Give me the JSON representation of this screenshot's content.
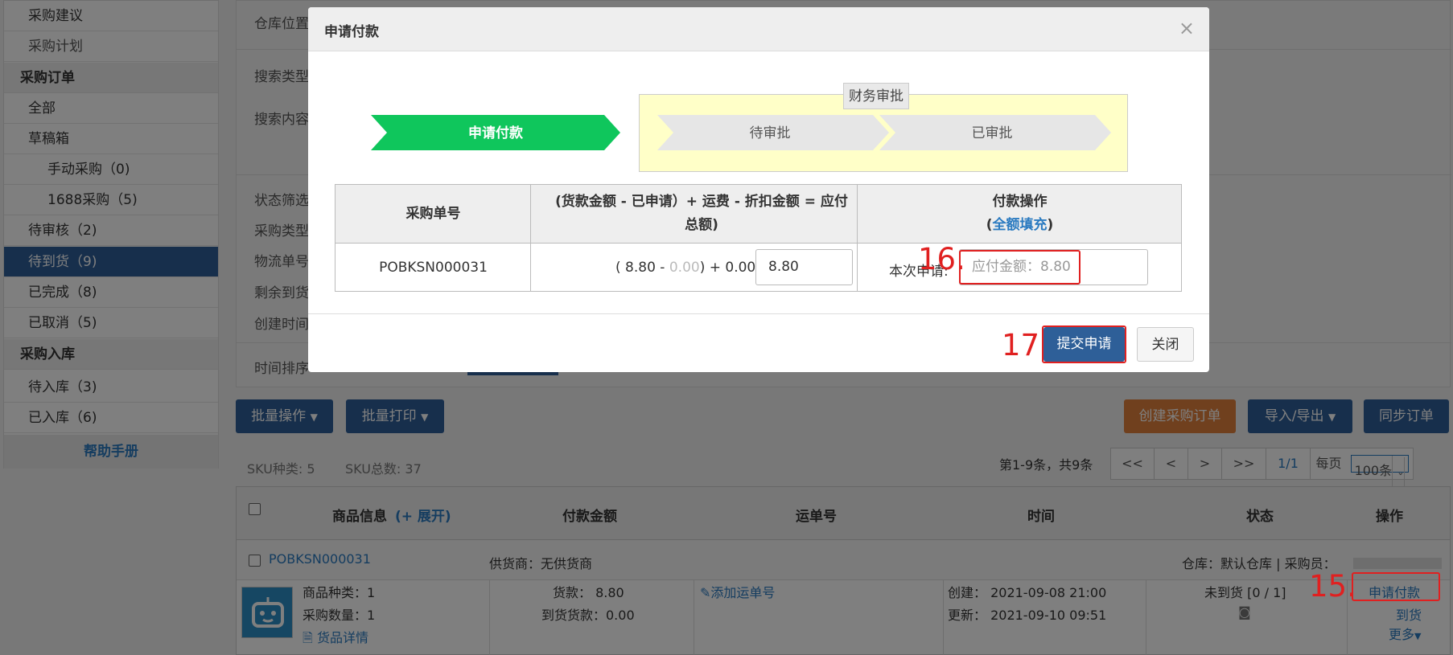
{
  "sidebar": {
    "items": [
      {
        "label": "采购建议"
      },
      {
        "label": "采购计划"
      },
      {
        "label": "采购订单"
      },
      {
        "label": "全部"
      },
      {
        "label": "草稿箱"
      },
      {
        "label": "手动采购（0)"
      },
      {
        "label": "1688采购（5)"
      },
      {
        "label": "待审核（2)"
      },
      {
        "label": "待到货（9)"
      },
      {
        "label": "已完成（8)"
      },
      {
        "label": "已取消（5)"
      },
      {
        "label": "采购入库"
      },
      {
        "label": "待入库（3)"
      },
      {
        "label": "已入库（6)"
      }
    ],
    "help": "帮助手册"
  },
  "filters": {
    "warehouse": "仓库位置",
    "search_type": "搜索类型",
    "search_content": "搜索内容",
    "status": "状态筛选",
    "purchase_type": "采购类型",
    "logistics": "物流单号",
    "remaining": "剩余到货",
    "created": "创建时间",
    "sort": "时间排序"
  },
  "toolbar": {
    "batch_ops": "批量操作",
    "batch_print": "批量打印",
    "create_order": "创建采购订单",
    "import_export": "导入/导出",
    "sync_order": "同步订单"
  },
  "stats": {
    "sku_kinds": "SKU种类: 5",
    "sku_total": "SKU总数: 37",
    "range": "第1-9条，共9条"
  },
  "pager": {
    "first": "<<",
    "prev": "<",
    "next": ">",
    "last": ">>",
    "page": "1/1",
    "per_page_label": "每页",
    "per_page": "100条"
  },
  "table": {
    "headers": {
      "product": "商品信息",
      "expand": "(+ 展开)",
      "amount": "付款金额",
      "tracking": "运单号",
      "time": "时间",
      "status": "状态",
      "action": "操作"
    },
    "order": {
      "id": "POBKSN000031",
      "supplier": "供货商：无供货商",
      "warehouse": "仓库：默认仓库 | 采购员："
    },
    "row": {
      "kinds": "商品种类：1",
      "qty": "采购数量：1",
      "detail": "货品详情",
      "goods": "货款：  8.80",
      "arrived_goods": "到货货款：0.00",
      "add_tracking": "添加运单号",
      "created": "创建：  2021-09-08 21:00",
      "updated": "更新：  2021-09-10 09:51",
      "status": "未到货 [0 / 1]",
      "request_payment": "申请付款",
      "arrive": "到货",
      "more": "更多"
    }
  },
  "modal": {
    "title": "申请付款",
    "close_x": "×",
    "steps": {
      "group_label": "财务审批",
      "step1": "申请付款",
      "step2": "待审批",
      "step3": "已审批"
    },
    "pay_table": {
      "col1": "采购单号",
      "col2": "(货款金额 - 已申请）+ 运费 - 折扣金额 = 应付总额)",
      "col3": "付款操作",
      "fill_all": "全额填充",
      "paren_open": "(",
      "paren_close": ")",
      "order_no": "POBKSN000031",
      "formula_a": "( 8.80 - ",
      "formula_applied": "0.00",
      "formula_b": ") + 0.00 =",
      "total_value": "8.80",
      "this_request": "本次申请:",
      "pay_placeholder": "应付金额：8.80"
    },
    "submit": "提交申请",
    "close": "关闭"
  },
  "annotations": {
    "n15": "15.",
    "n16": "16.",
    "n17": "17."
  },
  "colors": {
    "primary": "#2e5f98",
    "green_step": "#0fc65c",
    "highlight_red": "#e02020",
    "orange": "#e0803d",
    "link": "#2a7ac0"
  }
}
